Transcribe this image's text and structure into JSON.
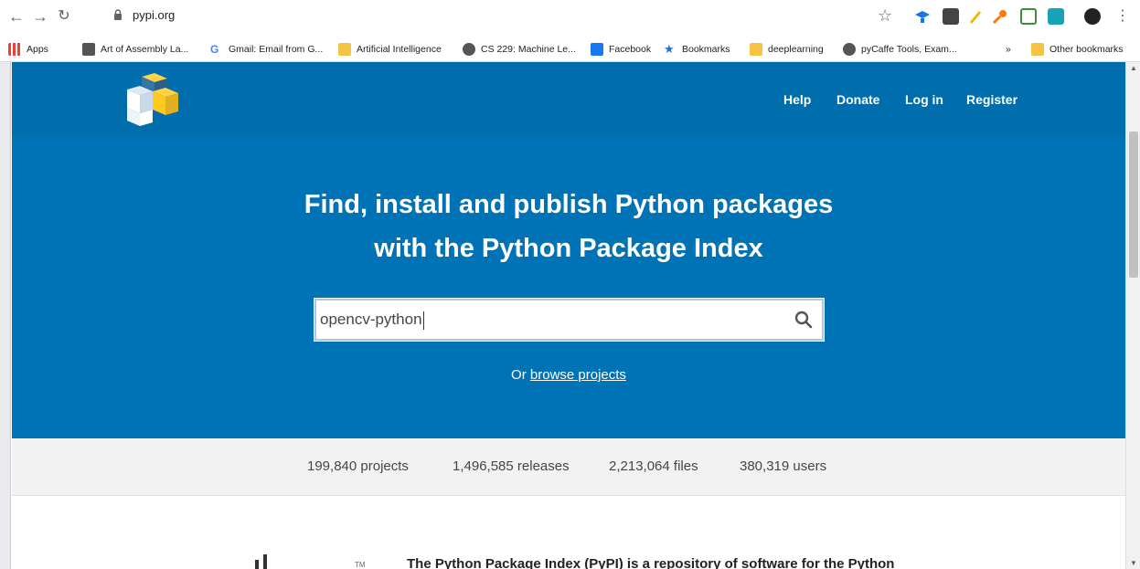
{
  "browser": {
    "url": "pypi.org",
    "bookmarks": [
      {
        "label": "Apps"
      },
      {
        "label": "Art of Assembly La..."
      },
      {
        "label": "Gmail: Email from G..."
      },
      {
        "label": "Artificial Intelligence"
      },
      {
        "label": "CS 229: Machine Le..."
      },
      {
        "label": "Facebook"
      },
      {
        "label": "Bookmarks"
      },
      {
        "label": "deeplearning"
      },
      {
        "label": "pyCaffe Tools, Exam..."
      }
    ],
    "overflow": "»",
    "other_bookmarks": "Other bookmarks"
  },
  "header": {
    "nav": [
      "Help",
      "Donate",
      "Log in",
      "Register"
    ]
  },
  "hero": {
    "title_line1": "Find, install and publish Python packages",
    "title_line2": "with the Python Package Index",
    "search_value": "opencv-python",
    "browse_prefix": "Or",
    "browse_link": "browse projects"
  },
  "stats": {
    "projects": "199,840 projects",
    "releases": "1,496,585 releases",
    "files": "2,213,064 files",
    "users": "380,319 users"
  },
  "intro": {
    "tm": "TM",
    "text": "The Python Package Index (PyPI) is a repository of software for the Python"
  },
  "colors": {
    "header_bg": "#006dad",
    "hero_bg": "#0073b7",
    "stats_bg": "#f2f2f2"
  }
}
